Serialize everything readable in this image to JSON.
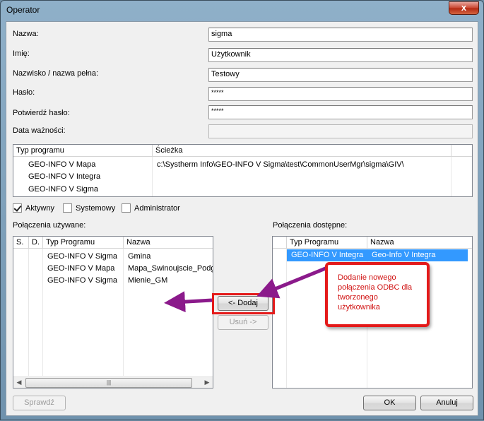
{
  "window": {
    "title": "Operator",
    "close_glyph": "x"
  },
  "fields": [
    {
      "label": "Nazwa:",
      "value": "sigma"
    },
    {
      "label": "Imię:",
      "value": "Użytkownik"
    },
    {
      "label": "Nazwisko / nazwa pełna:",
      "value": "Testowy"
    },
    {
      "label": "Hasło:",
      "value": "*****"
    },
    {
      "label": "Potwierdź hasło:",
      "value": "*****"
    },
    {
      "label": "Data ważności:",
      "value": ""
    }
  ],
  "program_table": {
    "columns": [
      "Typ programu",
      "Ścieżka"
    ],
    "rows": [
      {
        "type": "GEO-INFO V Mapa",
        "path": "c:\\Systherm Info\\GEO-INFO V Sigma\\test\\CommonUserMgr\\sigma\\GIV\\"
      },
      {
        "type": "GEO-INFO V Integra",
        "path": ""
      },
      {
        "type": "GEO-INFO V Sigma",
        "path": ""
      }
    ]
  },
  "checkboxes": [
    {
      "label": "Aktywny",
      "checked": true
    },
    {
      "label": "Systemowy",
      "checked": false
    },
    {
      "label": "Administrator",
      "checked": false
    }
  ],
  "used_connections": {
    "label": "Połączenia używane:",
    "columns": [
      "S.",
      "D.",
      "Typ Programu",
      "Nazwa"
    ],
    "rows": [
      {
        "type": "GEO-INFO V Sigma",
        "name": "Gmina"
      },
      {
        "type": "GEO-INFO V Mapa",
        "name": "Mapa_Swinoujscie_Podg"
      },
      {
        "type": "GEO-INFO V Sigma",
        "name": "Mienie_GM"
      }
    ]
  },
  "available_connections": {
    "label": "Połączenia dostępne:",
    "columns": [
      "Typ Programu",
      "Nazwa"
    ],
    "rows": [
      {
        "type": "GEO-INFO V Integra",
        "name": "Geo-Info V Integra",
        "selected": true
      }
    ]
  },
  "buttons": {
    "add": "<- Dodaj",
    "remove": "Usuń ->",
    "check": "Sprawdź",
    "ok": "OK",
    "cancel": "Anuluj"
  },
  "annotation": {
    "text": "Dodanie nowego połączenia ODBC dla tworzonego użytkownika",
    "color": "#e41a1a",
    "arrow_color": "#8b1a8b"
  },
  "colors": {
    "selection": "#3399ff"
  }
}
